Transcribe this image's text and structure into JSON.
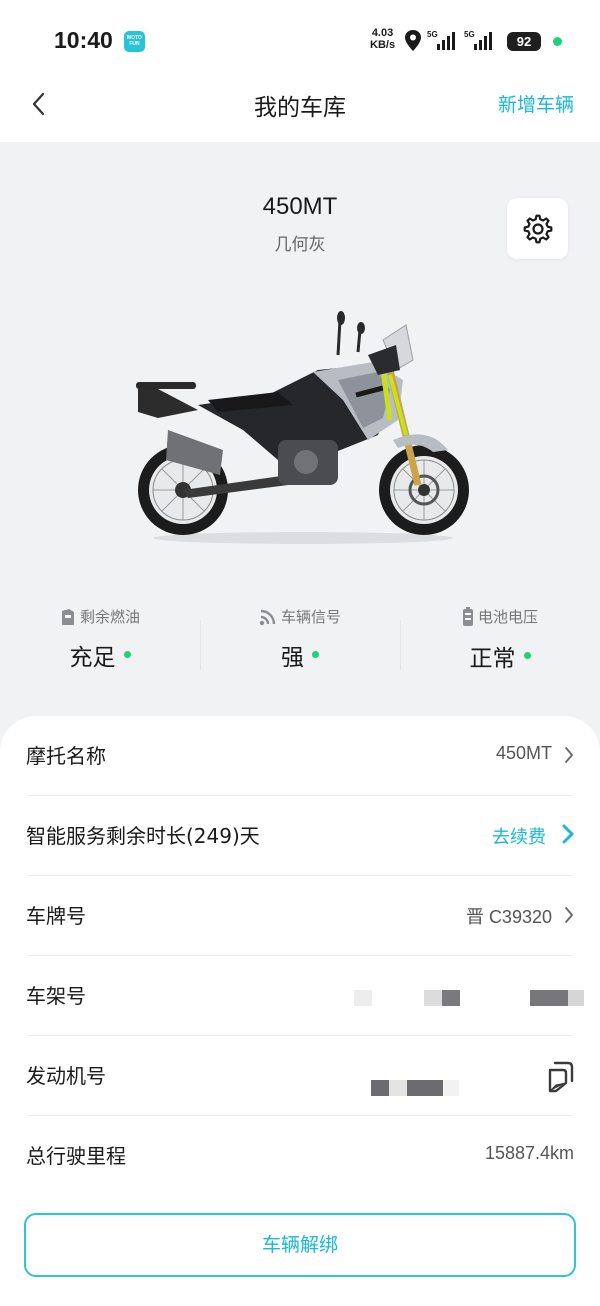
{
  "status_bar": {
    "time": "10:40",
    "app_badge": "MOTO FUN",
    "speed_value": "4.03",
    "speed_unit": "KB/s",
    "network_1": "5G",
    "network_2": "5G",
    "battery": "92"
  },
  "nav": {
    "back_icon": "chevron-left-icon",
    "title": "我的车库",
    "action": "新增车辆"
  },
  "vehicle": {
    "model": "450MT",
    "color": "几何灰",
    "settings_icon": "gear-icon"
  },
  "stats": [
    {
      "icon": "fuel-icon",
      "label": "剩余燃油",
      "value": "充足"
    },
    {
      "icon": "signal-icon",
      "label": "车辆信号",
      "value": "强"
    },
    {
      "icon": "battery-icon",
      "label": "电池电压",
      "value": "正常"
    }
  ],
  "info": {
    "name_label": "摩托名称",
    "name_value": "450MT",
    "service_label": "智能服务剩余时长(249)天",
    "service_action": "去续费",
    "plate_label": "车牌号",
    "plate_value": "晋 C39320",
    "frame_label": "车架号",
    "engine_label": "发动机号",
    "mileage_label": "总行驶里程",
    "mileage_value": "15887.4km"
  },
  "unbind_button": "车辆解绑",
  "colors": {
    "accent": "#19b9d3",
    "status_ok": "#1fd17a",
    "background": "#f1f2f4"
  }
}
